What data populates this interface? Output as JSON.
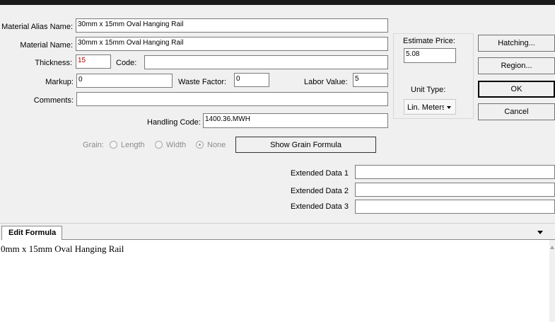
{
  "form": {
    "alias_label": "Material Alias Name:",
    "alias_value": "30mm x 15mm Oval Hanging Rail",
    "name_label": "Material Name:",
    "name_value": "30mm x 15mm Oval Hanging Rail",
    "thickness_label": "Thickness:",
    "thickness_value": "15",
    "code_label": "Code:",
    "code_value": "",
    "markup_label": "Markup:",
    "markup_value": "0",
    "waste_label": "Waste Factor:",
    "waste_value": "0",
    "labor_label": "Labor Value:",
    "labor_value": "5",
    "comments_label": "Comments:",
    "comments_value": "",
    "handling_label": "Handling Code:",
    "handling_value": "1400.36.MWH"
  },
  "estimate": {
    "price_label": "Estimate Price:",
    "price_value": "5.08",
    "unit_label": "Unit Type:",
    "unit_value": "Lin. Meters"
  },
  "buttons": {
    "hatching": "Hatching...",
    "region": "Region...",
    "ok": "OK",
    "cancel": "Cancel",
    "show_grain": "Show Grain Formula"
  },
  "grain": {
    "label": "Grain:",
    "options": [
      "Length",
      "Width",
      "None"
    ],
    "selected": "None"
  },
  "extended": {
    "labels": [
      "Extended Data 1",
      "Extended Data 2",
      "Extended Data 3"
    ],
    "values": [
      "",
      "",
      ""
    ]
  },
  "formula": {
    "tab_label": "Edit Formula",
    "text": "0mm x 15mm Oval Hanging Rail"
  },
  "colors": {
    "title_bar": "#1a1a1a",
    "thickness_text": "#c00000"
  }
}
